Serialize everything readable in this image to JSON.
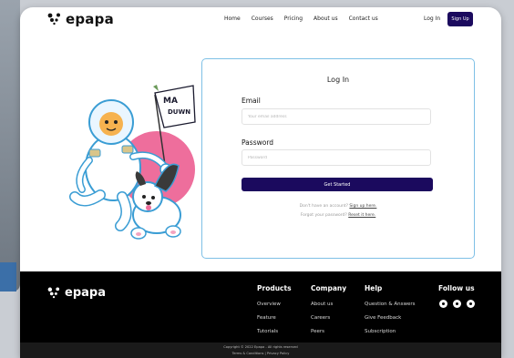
{
  "brand": {
    "name": "epapa"
  },
  "nav": {
    "links": [
      "Home",
      "Courses",
      "Pricing",
      "About us",
      "Contact us"
    ],
    "login": "Log In",
    "signup": "Sign Up"
  },
  "illustration": {
    "flag_text": "MA DUWN"
  },
  "login_card": {
    "title": "Log In",
    "email_label": "Email",
    "email_placeholder": "Your email address",
    "password_label": "Password",
    "password_placeholder": "Password",
    "submit": "Get Started",
    "no_account": "Don't have an account?",
    "signup_link": "Sign up here.",
    "forgot": "Forgot your password?",
    "reset_link": "Reset it here."
  },
  "footer": {
    "columns": [
      {
        "heading": "Products",
        "items": [
          "Overview",
          "Feature",
          "Tutorials"
        ]
      },
      {
        "heading": "Company",
        "items": [
          "About us",
          "Careers",
          "Peers"
        ]
      },
      {
        "heading": "Help",
        "items": [
          "Question & Answers",
          "Give Feedback",
          "Subscription"
        ]
      }
    ],
    "follow": "Follow us",
    "copyright": "Copyright © 2022 Epapa - All rights reserved",
    "legal": "Terms & Conditions | Privacy Policy"
  },
  "colors": {
    "accent": "#1b0a5e",
    "card_border": "#7ec0e6",
    "footer_bg": "#000000"
  }
}
